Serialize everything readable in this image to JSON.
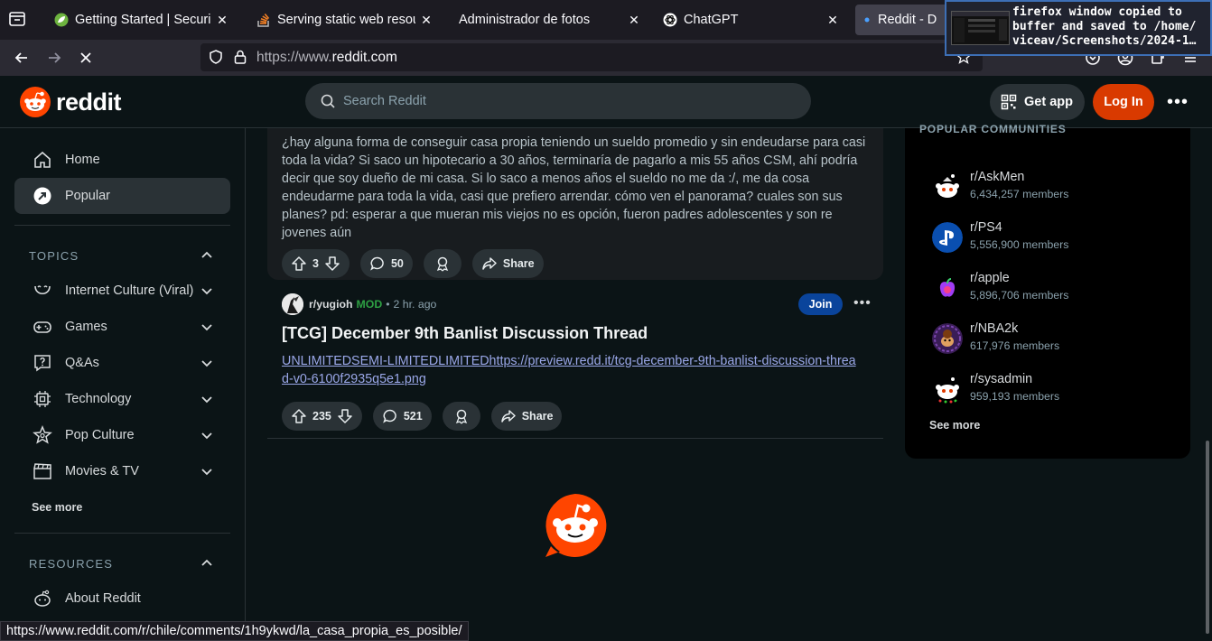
{
  "browser": {
    "tabs": [
      {
        "label": "Getting Started | Securing",
        "icon": "spring-leaf-icon"
      },
      {
        "label": "Serving static web resour",
        "icon": "stackoverflow-icon"
      },
      {
        "label": "Administrador de fotos",
        "icon": ""
      },
      {
        "label": "ChatGPT",
        "icon": "chatgpt-icon"
      },
      {
        "label": "Reddit - D",
        "icon": "loading-dot-icon"
      }
    ],
    "close_glyph": "✕",
    "url_prefix": "https://www.",
    "url_host": "reddit.com",
    "status_url": "https://www.reddit.com/r/chile/comments/1h9ykwd/la_casa_propia_es_posible/"
  },
  "notification": {
    "text": "firefox window copied to\nbuffer and saved to /home/\nviceav/Screenshots/2024-1…"
  },
  "header": {
    "wordmark": "reddit",
    "search_placeholder": "Search Reddit",
    "get_app": "Get app",
    "login": "Log In",
    "more": "•••"
  },
  "sidebar": {
    "home": "Home",
    "popular": "Popular",
    "topics_heading": "TOPICS",
    "topics": [
      {
        "label": "Internet Culture (Viral)",
        "icon": "smile-icon"
      },
      {
        "label": "Games",
        "icon": "gamepad-icon"
      },
      {
        "label": "Q&As",
        "icon": "question-icon"
      },
      {
        "label": "Technology",
        "icon": "chip-icon"
      },
      {
        "label": "Pop Culture",
        "icon": "star-icon"
      },
      {
        "label": "Movies & TV",
        "icon": "clapperboard-icon"
      }
    ],
    "see_more": "See more",
    "resources_heading": "RESOURCES",
    "about": "About Reddit"
  },
  "feed": {
    "post1": {
      "body": "¿hay alguna forma de conseguir casa propia teniendo un sueldo promedio y sin endeudarse para casi toda la vida? Si saco un hipotecario a 30 años, terminaría de pagarlo a mis 55 años CSM, ahí podría decir que soy dueño de mi casa. Si lo saco a menos años el sueldo no me da :/, me da cosa endeudarme para toda la vida, casi que prefiero arrendar. cómo ven el panorama? cuales son sus planes? pd: esperar a que mueran mis viejos no es opción, fueron padres adolescentes y son re jovenes aún",
      "votes": "3",
      "comments": "50",
      "share": "Share"
    },
    "post2": {
      "subreddit": "r/yugioh",
      "flair": "MOD",
      "separator": "•",
      "age": "2 hr. ago",
      "join": "Join",
      "more": "•••",
      "title": "[TCG] December 9th Banlist Discussion Thread",
      "link": "UNLIMITEDSEMI-LIMITEDLIMITEDhttps://preview.redd.it/tcg-december-9th-banlist-discussion-thread-v0-6100f2935q5e1.png",
      "votes": "235",
      "comments": "521",
      "share": "Share"
    }
  },
  "right_sidebar": {
    "heading": "POPULAR COMMUNITIES",
    "communities": [
      {
        "name": "r/AskMen",
        "members": "6,434,257 members",
        "icon": "snoo-avatar-icon"
      },
      {
        "name": "r/PS4",
        "members": "5,556,900 members",
        "icon": "playstation-icon"
      },
      {
        "name": "r/apple",
        "members": "5,896,706 members",
        "icon": "apple-icon"
      },
      {
        "name": "r/NBA2k",
        "members": "617,976 members",
        "icon": "nba2k-avatar-icon"
      },
      {
        "name": "r/sysadmin",
        "members": "959,193 members",
        "icon": "snoo-christmas-icon"
      }
    ],
    "see_more": "See more"
  },
  "colors": {
    "reddit_orange": "#ff4500",
    "login_bg": "#d93a00",
    "join_bg": "#0a449b",
    "mod_green": "#2ea043"
  }
}
